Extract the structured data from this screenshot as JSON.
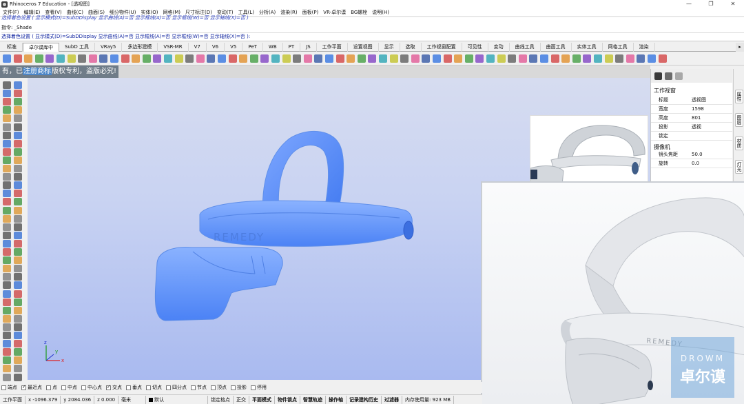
{
  "title": "Rhinoceros 7 Education - [透视图]",
  "window_controls": [
    "—",
    "❐",
    "✕"
  ],
  "menu": [
    "文件(F)",
    "编辑(E)",
    "查看(V)",
    "曲线(C)",
    "曲面(S)",
    "细分物件(U)",
    "实体(O)",
    "网格(M)",
    "尺寸标注(D)",
    "变动(T)",
    "工具(L)",
    "分析(A)",
    "渲染(R)",
    "面板(P)",
    "VR-卓尔谟",
    "BG螺栓",
    "说明(H)"
  ],
  "command": {
    "history": "选择着色设置 ( 显示模式(D)=SubDDisplay  显示曲线(A)=否  显示框线(A)=否  显示框线(W)=否  显示轴线(X)=否 )",
    "prompt": "指令: _Shade",
    "input": "选择着色设置 ( 显示模式(D)=SubDDisplay  显示曲线(A)=否  显示框线(A)=否  显示框线(W)=否  显示轴线(X)=否 ):"
  },
  "tabs": [
    "标准",
    "卓尔谟库中",
    "SubD 工具",
    "VRay5",
    "多边形建模",
    "VSR-MR",
    "V7",
    "V6",
    "V5",
    "PeT",
    "WB",
    "PT",
    "JS",
    "工作平面",
    "设置视图",
    "显示",
    "选取",
    "工作视窗配置",
    "可见性",
    "变动",
    "曲线工具",
    "曲面工具",
    "实体工具",
    "网格工具",
    "渲染"
  ],
  "active_tab_index": 1,
  "banner": {
    "left": "有，已",
    "highlight": "注册商标",
    "right": "版权专利，盗版必究!"
  },
  "viewport": {
    "model_text": "REMEDY",
    "axis_x": "x",
    "axis_y": "y",
    "axis_z": "z"
  },
  "properties": {
    "title": "工作视窗",
    "rows": [
      {
        "k": "标题",
        "v": "透视图"
      },
      {
        "k": "宽度",
        "v": "1598"
      },
      {
        "k": "高度",
        "v": "801"
      },
      {
        "k": "投影",
        "v": "透视"
      },
      {
        "k": "锁定",
        "v": ""
      }
    ],
    "camera_title": "摄像机",
    "camera_rows": [
      {
        "k": "镜头焦距",
        "v": "50.0"
      },
      {
        "k": "旋转",
        "v": "0.0"
      }
    ]
  },
  "side_tabs": [
    "属性",
    "图层",
    "材质",
    "灯光",
    "已命名"
  ],
  "watermark": {
    "line1": "DROWM",
    "line2": "卓尔谟"
  },
  "render_logo": "REMEDY",
  "snaps": [
    {
      "label": "端点",
      "on": false
    },
    {
      "label": "最近点",
      "on": true
    },
    {
      "label": "点",
      "on": false
    },
    {
      "label": "中点",
      "on": false
    },
    {
      "label": "中心点",
      "on": false
    },
    {
      "label": "交点",
      "on": true
    },
    {
      "label": "垂点",
      "on": false
    },
    {
      "label": "切点",
      "on": false
    },
    {
      "label": "四分点",
      "on": false
    },
    {
      "label": "节点",
      "on": false
    },
    {
      "label": "顶点",
      "on": false
    },
    {
      "label": "投影",
      "on": false
    },
    {
      "label": "停用",
      "on": false
    }
  ],
  "status": {
    "plane": "工作平面",
    "x": "x -1096.379",
    "y": "y 2084.036",
    "z": "z 0.000",
    "unit": "毫米",
    "layer": "默认",
    "toggles": [
      "锁定格点",
      "正交",
      "平面模式",
      "物件锁点",
      "智慧轨迹",
      "操作轴",
      "记录建构历史",
      "过滤器"
    ],
    "memory": "内存使用量: 923 MB"
  }
}
